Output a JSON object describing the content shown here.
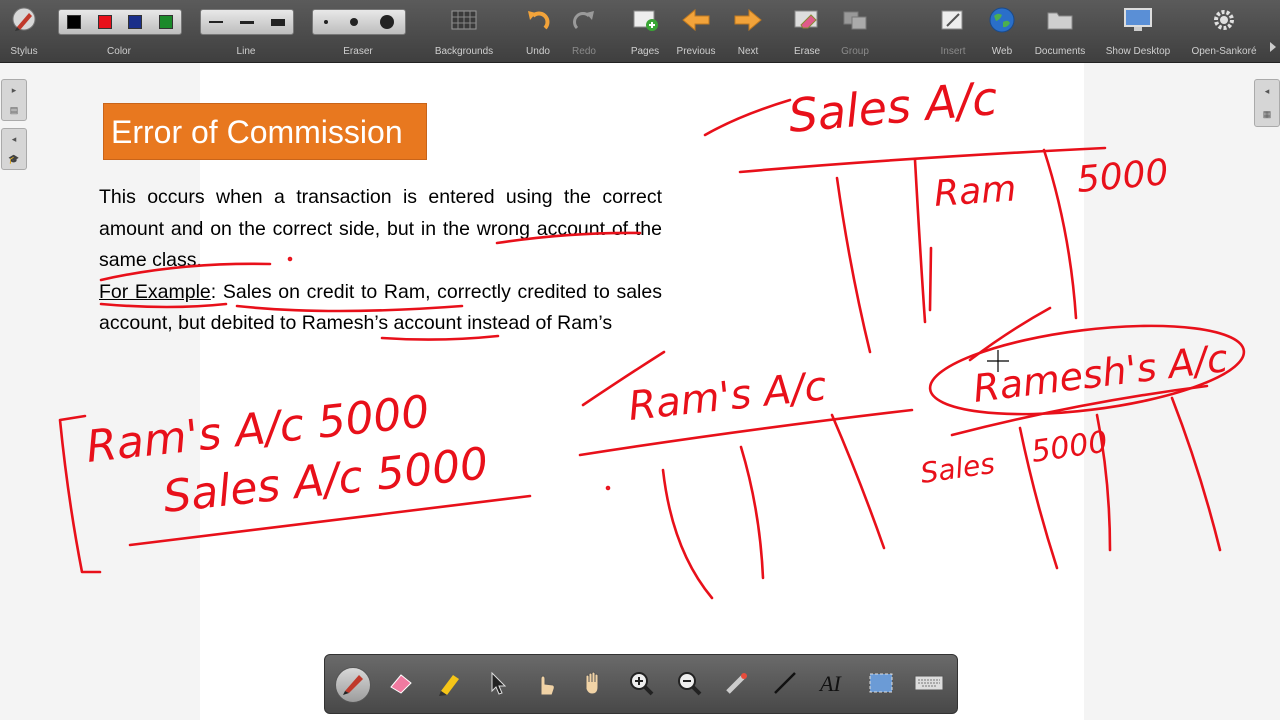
{
  "toolbar": {
    "stylus": "Stylus",
    "color": "Color",
    "line": "Line",
    "eraser": "Eraser",
    "backgrounds": "Backgrounds",
    "undo": "Undo",
    "redo": "Redo",
    "pages": "Pages",
    "previous": "Previous",
    "next": "Next",
    "erase": "Erase",
    "group": "Group",
    "insert": "Insert",
    "web": "Web",
    "documents": "Documents",
    "show_desktop": "Show Desktop",
    "open_sankore": "Open-Sankoré"
  },
  "colors": {
    "swatches": [
      "#000000",
      "#e8101a",
      "#1a2f8a",
      "#1b8a2a"
    ],
    "title_bg": "#e8781f",
    "ink": "#e8101a"
  },
  "slide": {
    "title": "Error of Commission",
    "para1": "This occurs when a transaction is entered using the correct amount and on the correct side, but in the wrong account of the same class.",
    "example_label": "For Example",
    "example_colon": ":",
    "example_text": " Sales on credit to Ram, correctly credited to sales account, but debited to Ramesh’s account instead of Ram’s"
  },
  "annotations": {
    "sales_ac": "Sales A/c",
    "ram": "Ram",
    "sales_amount": "5000",
    "rams_ac": "Ram's A/c",
    "rameshs_ac": "Ramesh's A/c",
    "sales": "Sales",
    "ramesh_amount": "5000",
    "journal_debit": "Ram's A/c 5000",
    "journal_credit": "Sales A/c 5000"
  },
  "bottom_tools": [
    "pen-tool",
    "eraser-tool",
    "marker-tool",
    "selector-tool",
    "play-tool",
    "hand-tool",
    "zoom-in-tool",
    "zoom-out-tool",
    "laser-pointer-tool",
    "line-tool",
    "text-tool",
    "capture-tool",
    "keyboard-tool"
  ]
}
